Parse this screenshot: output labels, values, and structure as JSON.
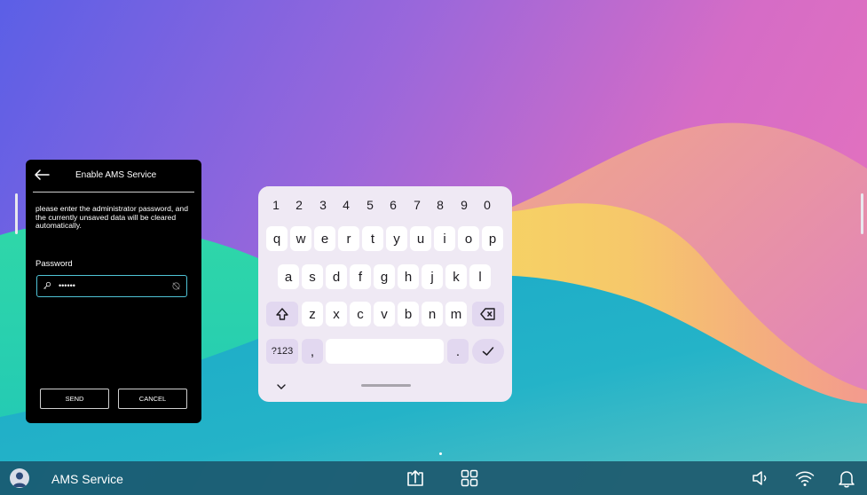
{
  "dialog": {
    "title": "Enable AMS Service",
    "message": "please enter the administrator password, and the currently unsaved data will be cleared automatically.",
    "password_label": "Password",
    "password_value": "••••••",
    "send_label": "SEND",
    "cancel_label": "CANCEL"
  },
  "keyboard": {
    "numbers": [
      "1",
      "2",
      "3",
      "4",
      "5",
      "6",
      "7",
      "8",
      "9",
      "0"
    ],
    "row1": [
      "q",
      "w",
      "e",
      "r",
      "t",
      "y",
      "u",
      "i",
      "o",
      "p"
    ],
    "row2": [
      "a",
      "s",
      "d",
      "f",
      "g",
      "h",
      "j",
      "k",
      "l"
    ],
    "row3": [
      "z",
      "x",
      "c",
      "v",
      "b",
      "n",
      "m"
    ],
    "symbols_label": "?123",
    "comma_label": ",",
    "period_label": "."
  },
  "taskbar": {
    "app_name": "AMS Service"
  },
  "icons": {
    "back": "arrow-left-icon",
    "key": "key-icon",
    "visibility": "eye-off-icon",
    "shift": "shift-icon",
    "backspace": "backspace-icon",
    "enter": "check-icon",
    "collapse": "chevron-down-icon",
    "screen_share": "screen-share-icon",
    "apps": "apps-grid-icon",
    "volume": "volume-icon",
    "wifi": "wifi-icon",
    "notifications": "bell-icon"
  },
  "colors": {
    "dialog_bg": "#000000",
    "field_focus": "#4fc3d6",
    "keyboard_bg": "#efe9f4",
    "function_key": "#e2d8f0",
    "taskbar": "#10606e"
  }
}
